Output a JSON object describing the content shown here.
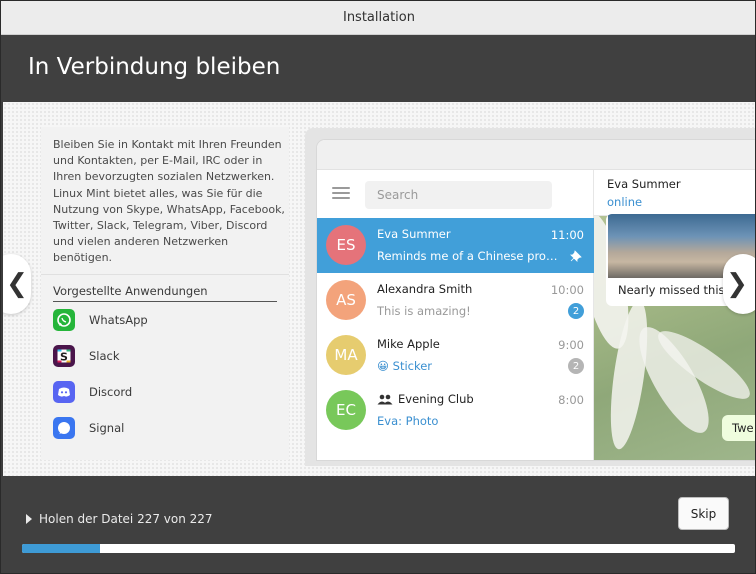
{
  "window": {
    "title": "Installation"
  },
  "header": {
    "title": "In Verbindung bleiben"
  },
  "slide": {
    "description": "Bleiben Sie in Kontakt mit Ihren Freunden und Kontakten, per E-Mail, IRC oder in Ihren bevorzugten sozialen Netzwerken. Linux Mint bietet alles, was Sie für die Nutzung von Skype, WhatsApp, Facebook, Twitter, Slack, Telegram, Viber, Discord und vielen anderen Netzwerken benötigen.",
    "apps_title": "Vorgestellte Anwendungen",
    "apps": [
      {
        "name": "WhatsApp",
        "icon": "whatsapp-icon",
        "color": "#25b53a"
      },
      {
        "name": "Slack",
        "icon": "slack-icon",
        "color": "#4a154b"
      },
      {
        "name": "Discord",
        "icon": "discord-icon",
        "color": "#5865f2"
      },
      {
        "name": "Signal",
        "icon": "signal-icon",
        "color": "#3a76f0"
      }
    ],
    "prev_glyph": "❮",
    "next_glyph": "❯"
  },
  "telegram": {
    "search_placeholder": "Search",
    "chats": [
      {
        "initials": "ES",
        "name": "Eva Summer",
        "time": "11:00",
        "message": "Reminds me of a Chinese prover...",
        "avatar_color": "#e5737a",
        "active": true,
        "pinned": true
      },
      {
        "initials": "AS",
        "name": "Alexandra Smith",
        "time": "10:00",
        "message": "This is amazing!",
        "avatar_color": "#f3a37b",
        "badge": "2",
        "badge_color": "#419fd9"
      },
      {
        "initials": "MA",
        "name": "Mike Apple",
        "time": "9:00",
        "message": "😀 Sticker",
        "avatar_color": "#e6cc6f",
        "badge": "2",
        "badge_color": "#b5b5b5"
      },
      {
        "initials": "EC",
        "name": "Evening Club",
        "time": "8:00",
        "message": "Eva: Photo",
        "avatar_color": "#78c85a"
      }
    ],
    "conversation": {
      "name": "Eva Summer",
      "status": "online",
      "photo_caption": "Nearly missed this s",
      "bubble_text": "Twe"
    },
    "accent": "#419fd9"
  },
  "footer": {
    "status": "Holen der Datei 227 von 227",
    "skip_label": "Skip",
    "progress_percent": 11
  }
}
